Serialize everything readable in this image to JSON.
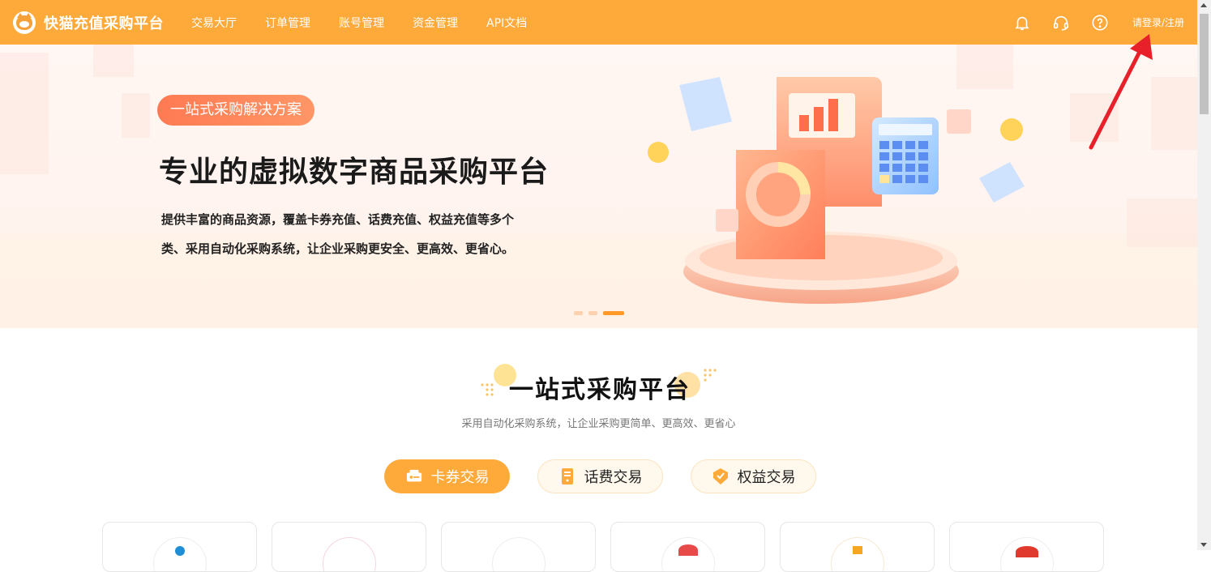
{
  "header": {
    "brand": "快猫充值采购平台",
    "nav": [
      "交易大厅",
      "订单管理",
      "账号管理",
      "资金管理",
      "API文档"
    ],
    "icons": [
      "bell-icon",
      "headset-icon",
      "help-icon"
    ],
    "login": "请登录/注册"
  },
  "banner": {
    "tag": "一站式采购解决方案",
    "title": "专业的虚拟数字商品采购平台",
    "desc_line1": "提供丰富的商品资源，覆盖卡券充值、话费充值、权益充值等多个",
    "desc_line2": "类、采用自动化采购系统，让企业采购更安全、更高效、更省心。",
    "slides_total": 3,
    "slide_active": 3
  },
  "section": {
    "title": "一站式采购平台",
    "subtitle": "采用自动化采购系统，让企业采购更简单、更高效、更省心"
  },
  "tabs": [
    {
      "label": "卡券交易",
      "icon": "ticket-icon",
      "active": true
    },
    {
      "label": "话费交易",
      "icon": "phone-icon",
      "active": false
    },
    {
      "label": "权益交易",
      "icon": "badge-icon",
      "active": false
    }
  ],
  "cards": [
    {
      "icon": "product-icon-1"
    },
    {
      "icon": "product-icon-2"
    },
    {
      "icon": "product-icon-3"
    },
    {
      "icon": "product-icon-4"
    },
    {
      "icon": "product-icon-5"
    },
    {
      "icon": "product-icon-6"
    }
  ],
  "colors": {
    "primary": "#fdaa3a",
    "banner_tag": "#ff7a52",
    "text_dark": "#1a1a1a",
    "annotation": "#e8202a"
  }
}
